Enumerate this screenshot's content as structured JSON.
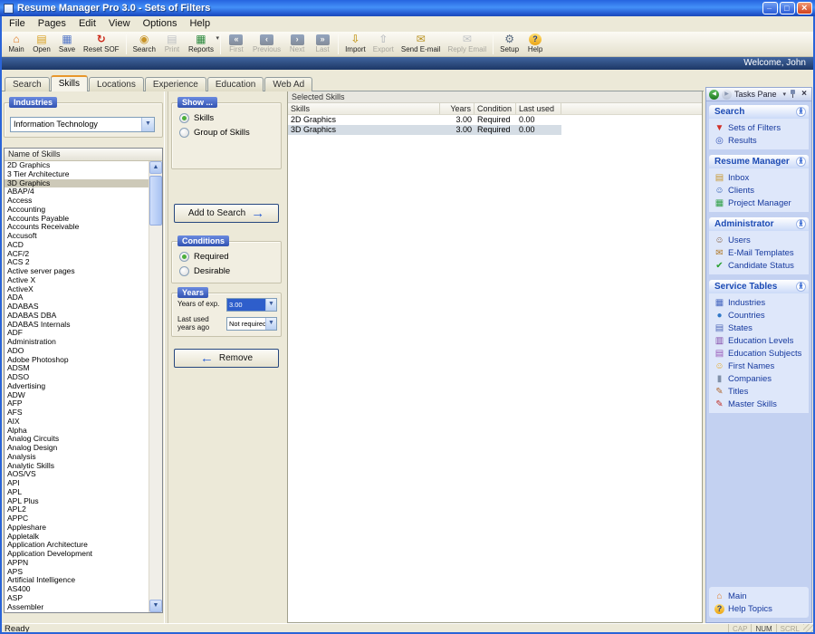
{
  "window": {
    "title": "Resume Manager Pro 3.0 - Sets of Filters",
    "welcome": "Welcome, John",
    "status": "Ready",
    "status_indicators": [
      {
        "label": "CAP",
        "active": false
      },
      {
        "label": "NUM",
        "active": true
      },
      {
        "label": "SCRL",
        "active": false
      }
    ]
  },
  "menu_bar": {
    "items": [
      {
        "label": "File"
      },
      {
        "label": "Pages"
      },
      {
        "label": "Edit"
      },
      {
        "label": "View"
      },
      {
        "label": "Options"
      },
      {
        "label": "Help"
      }
    ]
  },
  "toolbar": {
    "items": [
      {
        "label": "Main",
        "icon": "main",
        "enabled": true
      },
      {
        "label": "Open",
        "icon": "open",
        "enabled": true
      },
      {
        "label": "Save",
        "icon": "save",
        "enabled": true
      },
      {
        "label": "Reset SOF",
        "icon": "reset",
        "enabled": true
      },
      {
        "sep": true
      },
      {
        "label": "Search",
        "icon": "search",
        "enabled": true
      },
      {
        "label": "Print",
        "icon": "print",
        "enabled": false
      },
      {
        "label": "Reports",
        "icon": "reports",
        "enabled": true,
        "dropdown": true
      },
      {
        "sep": true
      },
      {
        "label": "First",
        "icon": "nav-first",
        "enabled": false
      },
      {
        "label": "Previous",
        "icon": "nav-prev",
        "enabled": false
      },
      {
        "label": "Next",
        "icon": "nav-next",
        "enabled": false
      },
      {
        "label": "Last",
        "icon": "nav-last",
        "enabled": false
      },
      {
        "sep": true
      },
      {
        "label": "Import",
        "icon": "import",
        "enabled": true
      },
      {
        "label": "Export",
        "icon": "export",
        "enabled": false
      },
      {
        "label": "Send E-mail",
        "icon": "send-email",
        "enabled": true
      },
      {
        "label": "Reply Email",
        "icon": "reply-email",
        "enabled": false
      },
      {
        "sep": true
      },
      {
        "label": "Setup",
        "icon": "setup",
        "enabled": true
      },
      {
        "label": "Help",
        "icon": "help",
        "enabled": true
      }
    ]
  },
  "tabs": {
    "items": [
      {
        "label": "Search"
      },
      {
        "label": "Skills",
        "active": true
      },
      {
        "label": "Locations"
      },
      {
        "label": "Experience"
      },
      {
        "label": "Education"
      },
      {
        "label": "Web Ad"
      }
    ]
  },
  "industries": {
    "group_label": "Industries",
    "selected": "Information Technology"
  },
  "skills_list": {
    "header": "Name of Skills",
    "selected": "3D Graphics",
    "items": [
      "2D Graphics",
      "3 Tier Architecture",
      "3D Graphics",
      "ABAP/4",
      "Access",
      "Accounting",
      "Accounts Payable",
      "Accounts Receivable",
      "Accusoft",
      "ACD",
      "ACF/2",
      "ACS 2",
      "Active server pages",
      "Active X",
      "ActiveX",
      "ADA",
      "ADABAS",
      "ADABAS DBA",
      "ADABAS Internals",
      "ADF",
      "Administration",
      "ADO",
      "Adobe Photoshop",
      "ADSM",
      "ADSO",
      "Advertising",
      "ADW",
      "AFP",
      "AFS",
      "AIX",
      "Alpha",
      "Analog Circuits",
      "Analog Design",
      "Analysis",
      "Analytic Skills",
      "AOS/VS",
      "API",
      "APL",
      "APL Plus",
      "APL2",
      "APPC",
      "Appleshare",
      "Appletalk",
      "Application Architecture",
      "Application Development",
      "APPN",
      "APS",
      "Artificial Intelligence",
      "AS400",
      "ASP",
      "Assembler"
    ]
  },
  "show_group": {
    "label": "Show ...",
    "options": [
      {
        "label": "Skills",
        "selected": true
      },
      {
        "label": "Group of Skills",
        "selected": false
      }
    ]
  },
  "conditions_group": {
    "label": "Conditions",
    "options": [
      {
        "label": "Required",
        "selected": true
      },
      {
        "label": "Desirable",
        "selected": false
      }
    ]
  },
  "years_group": {
    "label": "Years",
    "fields": [
      {
        "label": "Years of exp.",
        "value": "3.00",
        "highlighted": true
      },
      {
        "label": "Last used years ago",
        "value": "Not required",
        "highlighted": false
      }
    ]
  },
  "buttons": {
    "add_to_search": "Add to Search",
    "remove": "Remove"
  },
  "selected_skills": {
    "title": "Selected Skills",
    "columns": [
      "Skills",
      "Years",
      "Condition",
      "Last used"
    ],
    "rows": [
      {
        "skill": "2D Graphics",
        "years": "3.00",
        "condition": "Required",
        "last_used": "0.00"
      },
      {
        "skill": "3D Graphics",
        "years": "3.00",
        "condition": "Required",
        "last_used": "0.00",
        "selected": true
      }
    ]
  },
  "tasks_pane": {
    "title": "Tasks Pane",
    "sections": [
      {
        "title": "Search",
        "items": [
          {
            "label": "Sets of Filters",
            "icon": "filter"
          },
          {
            "label": "Results",
            "icon": "results"
          }
        ]
      },
      {
        "title": "Resume Manager",
        "items": [
          {
            "label": "Inbox",
            "icon": "inbox"
          },
          {
            "label": "Clients",
            "icon": "clients"
          },
          {
            "label": "Project Manager",
            "icon": "project"
          }
        ]
      },
      {
        "title": "Administrator",
        "items": [
          {
            "label": "Users",
            "icon": "users"
          },
          {
            "label": "E-Mail Templates",
            "icon": "email"
          },
          {
            "label": "Candidate Status",
            "icon": "status"
          }
        ]
      },
      {
        "title": "Service Tables",
        "items": [
          {
            "label": "Industries",
            "icon": "industries"
          },
          {
            "label": "Countries",
            "icon": "countries"
          },
          {
            "label": "States",
            "icon": "states"
          },
          {
            "label": "Education Levels",
            "icon": "edu-levels"
          },
          {
            "label": "Education Subjects",
            "icon": "edu-subjects"
          },
          {
            "label": "First Names",
            "icon": "first-names"
          },
          {
            "label": "Companies",
            "icon": "companies"
          },
          {
            "label": "Titles",
            "icon": "titles"
          },
          {
            "label": "Master Skills",
            "icon": "master-skills"
          }
        ]
      }
    ],
    "footer_items": [
      {
        "label": "Main",
        "icon": "home"
      },
      {
        "label": "Help Topics",
        "icon": "help"
      }
    ]
  }
}
